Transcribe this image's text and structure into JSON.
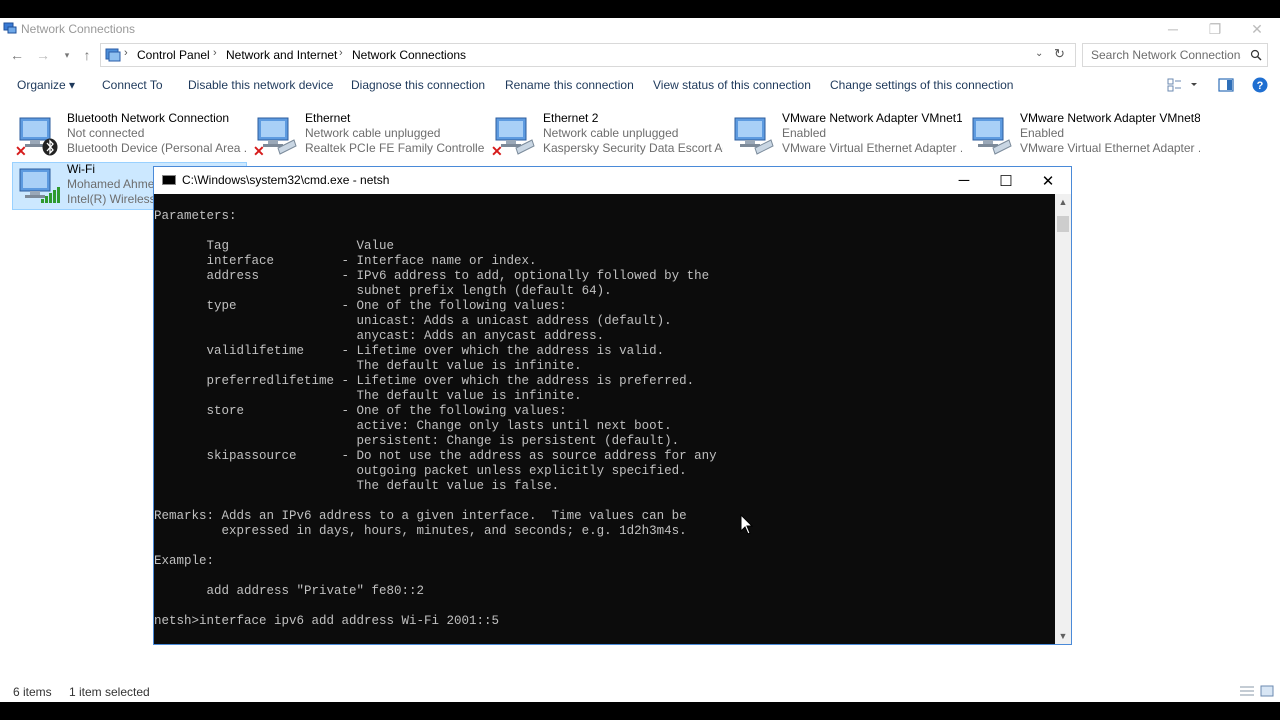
{
  "window": {
    "title": "Network Connections"
  },
  "address": {
    "crumbs": [
      "Control Panel",
      "Network and Internet",
      "Network Connections"
    ]
  },
  "search": {
    "placeholder": "Search Network Connections"
  },
  "toolbar": {
    "organize": "Organize ▾",
    "connect_to": "Connect To",
    "disable": "Disable this network device",
    "diagnose": "Diagnose this connection",
    "rename": "Rename this connection",
    "view_status": "View status of this connection",
    "change_settings": "Change settings of this connection"
  },
  "connections": [
    {
      "name": "Bluetooth Network Connection",
      "status": "Not connected",
      "device": "Bluetooth Device (Personal Area ...",
      "badge": "bluetooth"
    },
    {
      "name": "Ethernet",
      "status": "Network cable unplugged",
      "device": "Realtek PCIe FE Family Controller",
      "badge": "red-x"
    },
    {
      "name": "Ethernet 2",
      "status": "Network cable unplugged",
      "device": "Kaspersky Security Data Escort Ad...",
      "badge": "red-x"
    },
    {
      "name": "VMware Network Adapter VMnet1",
      "status": "Enabled",
      "device": "VMware Virtual Ethernet Adapter ...",
      "badge": "none"
    },
    {
      "name": "VMware Network Adapter VMnet8",
      "status": "Enabled",
      "device": "VMware Virtual Ethernet Adapter ...",
      "badge": "none"
    },
    {
      "name": "Wi-Fi",
      "status": "Mohamed Ahmed",
      "device": "Intel(R) Wireless-N",
      "badge": "signal",
      "selected": true
    }
  ],
  "cmd": {
    "title": "C:\\Windows\\system32\\cmd.exe - netsh",
    "output": [
      "Parameters:",
      "",
      "       Tag                 Value",
      "       interface         - Interface name or index.",
      "       address           - IPv6 address to add, optionally followed by the",
      "                           subnet prefix length (default 64).",
      "       type              - One of the following values:",
      "                           unicast: Adds a unicast address (default).",
      "                           anycast: Adds an anycast address.",
      "       validlifetime     - Lifetime over which the address is valid.",
      "                           The default value is infinite.",
      "       preferredlifetime - Lifetime over which the address is preferred.",
      "                           The default value is infinite.",
      "       store             - One of the following values:",
      "                           active: Change only lasts until next boot.",
      "                           persistent: Change is persistent (default).",
      "       skipassource      - Do not use the address as source address for any",
      "                           outgoing packet unless explicitly specified.",
      "                           The default value is false.",
      "",
      "Remarks: Adds an IPv6 address to a given interface.  Time values can be",
      "         expressed in days, hours, minutes, and seconds; e.g. 1d2h3m4s.",
      "",
      "Example:",
      "",
      "       add address \"Private\" fe80::2",
      "",
      "netsh>interface ipv6 add address Wi-Fi 2001::5"
    ]
  },
  "status": {
    "items": "6 items",
    "selected": "1 item selected"
  }
}
